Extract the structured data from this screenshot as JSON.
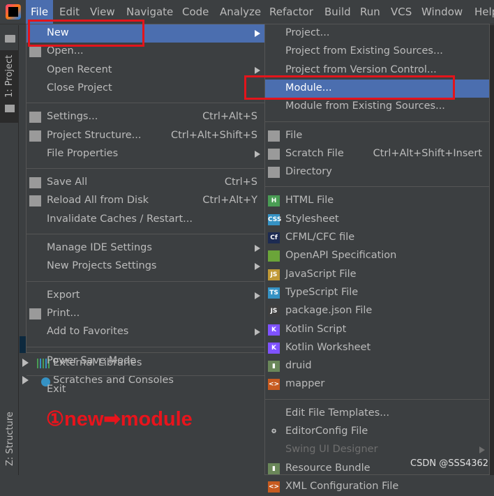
{
  "menubar": {
    "items": [
      "File",
      "Edit",
      "View",
      "Navigate",
      "Code",
      "Analyze",
      "Refactor",
      "Build",
      "Run",
      "VCS",
      "Window",
      "Help"
    ],
    "selected": "File"
  },
  "toolwindows": {
    "project": "1: Project",
    "structure": "Z: Structure"
  },
  "tree": {
    "items": [
      {
        "label": "External Libraries",
        "icon": "libraries-icon"
      },
      {
        "label": "Scratches and Consoles",
        "icon": "scratches-icon"
      }
    ]
  },
  "file_menu": [
    {
      "label": "New",
      "submenu": true,
      "highlighted": true
    },
    {
      "label": "Open...",
      "icon": "folder-icon"
    },
    {
      "label": "Open Recent",
      "submenu": true
    },
    {
      "label": "Close Project"
    },
    {
      "sep": true
    },
    {
      "label": "Settings...",
      "icon": "wrench-icon",
      "shortcut": "Ctrl+Alt+S"
    },
    {
      "label": "Project Structure...",
      "icon": "project-structure-icon",
      "shortcut": "Ctrl+Alt+Shift+S"
    },
    {
      "label": "File Properties",
      "submenu": true
    },
    {
      "sep": true
    },
    {
      "label": "Save All",
      "icon": "save-icon",
      "shortcut": "Ctrl+S"
    },
    {
      "label": "Reload All from Disk",
      "icon": "reload-icon",
      "shortcut": "Ctrl+Alt+Y"
    },
    {
      "label": "Invalidate Caches / Restart..."
    },
    {
      "sep": true
    },
    {
      "label": "Manage IDE Settings",
      "submenu": true
    },
    {
      "label": "New Projects Settings",
      "submenu": true
    },
    {
      "sep": true
    },
    {
      "label": "Export",
      "submenu": true
    },
    {
      "label": "Print...",
      "icon": "print-icon"
    },
    {
      "label": "Add to Favorites",
      "submenu": true
    },
    {
      "sep": true
    },
    {
      "label": "Power Save Mode"
    },
    {
      "sep": true
    },
    {
      "label": "Exit"
    }
  ],
  "new_submenu": [
    {
      "label": "Project..."
    },
    {
      "label": "Project from Existing Sources..."
    },
    {
      "label": "Project from Version Control..."
    },
    {
      "label": "Module...",
      "highlighted": true
    },
    {
      "label": "Module from Existing Sources..."
    },
    {
      "sep": true
    },
    {
      "label": "File",
      "icon": "file-icon"
    },
    {
      "label": "Scratch File",
      "icon": "scratch-file-icon",
      "shortcut": "Ctrl+Alt+Shift+Insert"
    },
    {
      "label": "Directory",
      "icon": "directory-icon"
    },
    {
      "sep": true
    },
    {
      "label": "HTML File",
      "icon": "html-file-icon",
      "badge": "H",
      "color": "#499c54"
    },
    {
      "label": "Stylesheet",
      "icon": "css-file-icon",
      "badge": "CSS",
      "color": "#3592c4"
    },
    {
      "label": "CFML/CFC file",
      "icon": "cfml-icon",
      "badge": "Cf",
      "color": "#1d2b52"
    },
    {
      "label": "OpenAPI Specification",
      "icon": "openapi-icon",
      "badge": "",
      "color": "#6ba539"
    },
    {
      "label": "JavaScript File",
      "icon": "js-file-icon",
      "badge": "JS",
      "color": "#c09936"
    },
    {
      "label": "TypeScript File",
      "icon": "ts-file-icon",
      "badge": "TS",
      "color": "#3592c4"
    },
    {
      "label": "package.json File",
      "icon": "nodejs-icon",
      "badge": "JS",
      "color": "#3f3f3f"
    },
    {
      "label": "Kotlin Script",
      "icon": "kotlin-script-icon",
      "badge": "K",
      "color": "#7f52ff"
    },
    {
      "label": "Kotlin Worksheet",
      "icon": "kotlin-worksheet-icon",
      "badge": "K",
      "color": "#7f52ff"
    },
    {
      "label": "druid",
      "icon": "druid-template-icon",
      "badge": "▮",
      "color": "#6a8759"
    },
    {
      "label": "mapper",
      "icon": "xml-file-icon",
      "badge": "<>",
      "color": "#c75b20"
    },
    {
      "sep": true
    },
    {
      "label": "Edit File Templates..."
    },
    {
      "label": "EditorConfig File",
      "icon": "gear-icon",
      "badge": "⚙",
      "color": "#3c3f41"
    },
    {
      "label": "Swing UI Designer",
      "submenu": true,
      "disabled": true
    },
    {
      "label": "Resource Bundle",
      "icon": "resource-bundle-icon",
      "badge": "▮",
      "color": "#6a8759"
    },
    {
      "label": "XML Configuration File",
      "icon": "xml-config-icon",
      "badge": "<>",
      "color": "#c75b20"
    }
  ],
  "annotation": "①new➡module",
  "watermark": "CSDN @SSS4362"
}
